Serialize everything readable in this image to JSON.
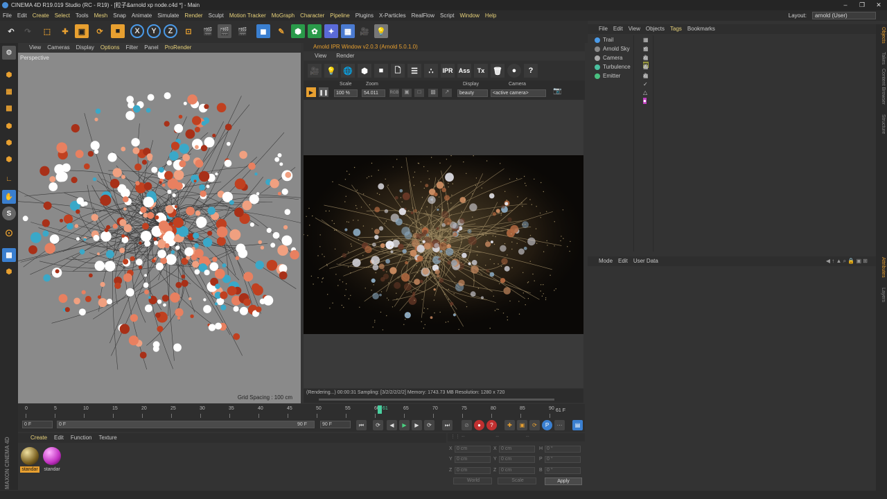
{
  "window": {
    "title": "CINEMA 4D R19.019 Studio (RC - R19) - [粒子&arnold xp node.c4d *] - Main"
  },
  "menubar": {
    "items": [
      "File",
      "Edit",
      "Create",
      "Select",
      "Tools",
      "Mesh",
      "Snap",
      "Animate",
      "Simulate",
      "Render",
      "Sculpt",
      "Motion Tracker",
      "MoGraph",
      "Character",
      "Pipeline",
      "Plugins",
      "X-Particles",
      "RealFlow",
      "Script",
      "Window",
      "Help"
    ],
    "layout_label": "Layout:",
    "layout_value": "arnold (User)"
  },
  "toolbar": {
    "x_label": "X",
    "y_label": "Y",
    "z_label": "Z"
  },
  "viewport": {
    "menu": [
      "View",
      "Cameras",
      "Display",
      "Options",
      "Filter",
      "Panel",
      "ProRender"
    ],
    "label": "Perspective",
    "grid_spacing": "Grid Spacing : 100 cm"
  },
  "ipr": {
    "title": "Arnold IPR Window v2.0.3 (Arnold 5.0.1.0)",
    "menu": [
      "View",
      "Render"
    ],
    "icons": {
      "ipr": "IPR",
      "ass": "Ass",
      "tx": "Tx",
      "help": "?"
    },
    "scale_label": "Scale",
    "scale_value": "100 %",
    "zoom_label": "Zoom",
    "zoom_value": "54.011",
    "display_label": "Display",
    "display_value": "beauty",
    "camera_label": "Camera",
    "camera_value": "<active camera>",
    "status": "(Rendering...)  00:00:31  Sampling: [3/2/2/2/2/2]  Memory: 1743.73 MB  Resolution: 1280 x 720"
  },
  "objects": {
    "menu": [
      "File",
      "Edit",
      "View",
      "Objects",
      "Tags",
      "Bookmarks"
    ],
    "items": [
      "Trail",
      "Arnold Sky",
      "Camera",
      "Turbulence",
      "Emitter"
    ]
  },
  "attributes": {
    "menu": [
      "Mode",
      "Edit",
      "User Data"
    ]
  },
  "right_tabs": [
    "Objects",
    "Takes",
    "Content Browser",
    "Structure",
    "Attributes",
    "Layers"
  ],
  "timeline": {
    "ticks": [
      "0",
      "5",
      "10",
      "15",
      "20",
      "25",
      "30",
      "35",
      "40",
      "45",
      "50",
      "55",
      "60",
      "65",
      "70",
      "75",
      "80",
      "85",
      "90"
    ],
    "current_marker": "61",
    "end_frame": "61 F"
  },
  "transport": {
    "start_field": "0 F",
    "range_start": "0 F",
    "range_end": "90 F",
    "end_field": "90 F",
    "key_p": "P"
  },
  "materials": {
    "menu": [
      "Create",
      "Edit",
      "Function",
      "Texture"
    ],
    "items": [
      "standar",
      "standar"
    ]
  },
  "coordinates": {
    "pos": {
      "x": "0 cm",
      "y": "0 cm",
      "z": "0 cm"
    },
    "size": {
      "x": "0 cm",
      "y": "0 cm",
      "z": "0 cm"
    },
    "rot": {
      "h": "0 °",
      "p": "0 °",
      "b": "0 °"
    },
    "mode_world": "World",
    "mode_scale": "Scale",
    "apply": "Apply"
  },
  "branding": {
    "maxon": "MAXON CINEMA 4D"
  }
}
